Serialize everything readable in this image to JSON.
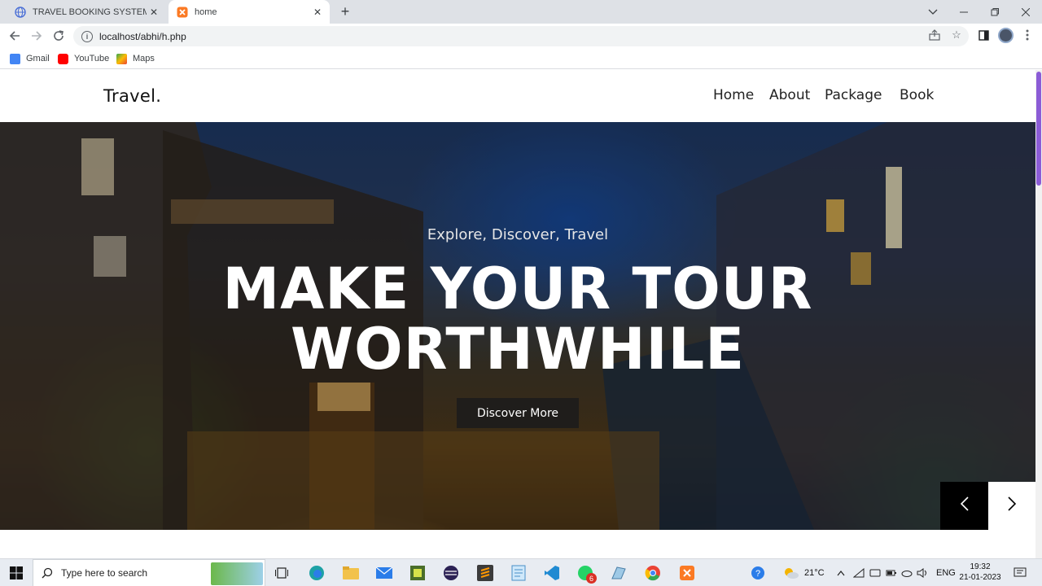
{
  "browser": {
    "tabs": [
      {
        "title": "TRAVEL BOOKING SYSTEM | Prezi",
        "active": false
      },
      {
        "title": "home",
        "active": true
      }
    ],
    "url": "localhost/abhi/h.php",
    "bookmarks": [
      {
        "label": "Gmail",
        "color": "#4285f4"
      },
      {
        "label": "YouTube",
        "color": "#ff0000"
      },
      {
        "label": "Maps",
        "color": "#34a853"
      }
    ]
  },
  "site": {
    "logo": "Travel.",
    "nav": [
      "Home",
      "About",
      "Package",
      "Book"
    ]
  },
  "hero": {
    "subtitle": "Explore, Discover, Travel",
    "title_line1": "MAKE YOUR TOUR",
    "title_line2": "WORTHWHILE",
    "button": "Discover More"
  },
  "taskbar": {
    "search_placeholder": "Type here to search",
    "temperature": "21°C",
    "language": "ENG",
    "time": "19:32",
    "date": "21-01-2023",
    "badge": "6"
  },
  "colors": {
    "accent_scroll": "#8b5cd6",
    "button_bg": "#1f1d1b"
  }
}
